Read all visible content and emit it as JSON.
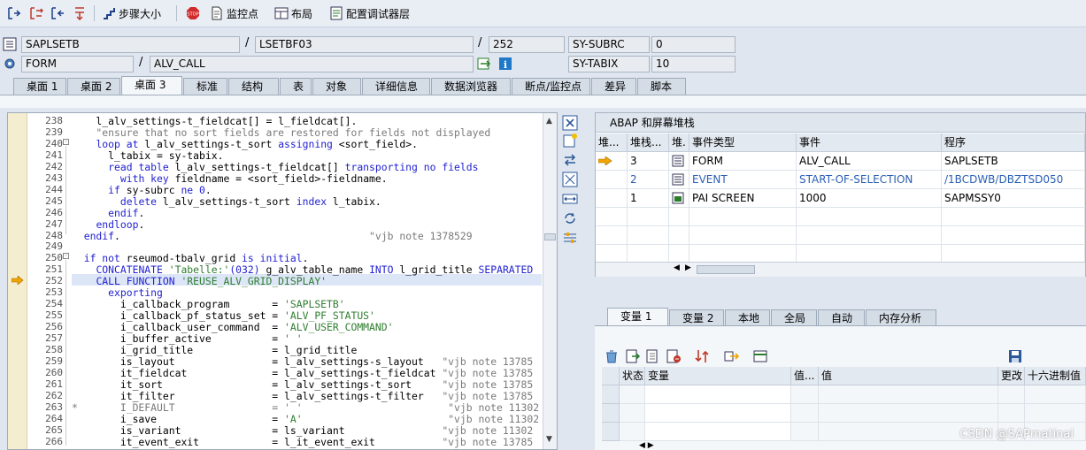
{
  "toolbar": {
    "step_size": "步骤大小",
    "watchpoint": "监控点",
    "layout": "布局",
    "config_layers": "配置调试器层"
  },
  "context": {
    "program": "SAPLSETB",
    "include": "LSETBF03",
    "line": "252",
    "subrc_label": "SY-SUBRC",
    "subrc_value": "0",
    "event_type": "FORM",
    "event_name": "ALV_CALL",
    "tabix_label": "SY-TABIX",
    "tabix_value": "10"
  },
  "tabs": [
    "桌面 1",
    "桌面 2",
    "桌面 3",
    "标准",
    "结构",
    "表",
    "对象",
    "详细信息",
    "数据浏览器",
    "断点/监控点",
    "差异",
    "脚本"
  ],
  "active_tab": "桌面 3",
  "code_lines": [
    {
      "n": "238",
      "segs": [
        [
          "t",
          "    l_alv_settings-t_fieldcat[] = l_fieldcat[]."
        ]
      ]
    },
    {
      "n": "239",
      "segs": [
        [
          "c",
          "    \"ensure that no sort fields are restored for fields not displayed"
        ]
      ]
    },
    {
      "n": "240",
      "segs": [
        [
          "t",
          "    "
        ],
        [
          "k",
          "loop at"
        ],
        [
          "t",
          " l_alv_settings-t_sort "
        ],
        [
          "k",
          "assigning"
        ],
        [
          "t",
          " <sort_field>."
        ]
      ]
    },
    {
      "n": "241",
      "segs": [
        [
          "t",
          "      l_tabix = sy-tabix."
        ]
      ]
    },
    {
      "n": "242",
      "segs": [
        [
          "t",
          "      "
        ],
        [
          "k",
          "read table"
        ],
        [
          "t",
          " l_alv_settings-t_fieldcat[] "
        ],
        [
          "k",
          "transporting no fields"
        ]
      ]
    },
    {
      "n": "243",
      "segs": [
        [
          "t",
          "        "
        ],
        [
          "k",
          "with key"
        ],
        [
          "t",
          " fieldname = <sort_field>-fieldname."
        ]
      ]
    },
    {
      "n": "244",
      "segs": [
        [
          "t",
          "      "
        ],
        [
          "k",
          "if"
        ],
        [
          "t",
          " sy-subrc "
        ],
        [
          "k",
          "ne"
        ],
        [
          "t",
          " "
        ],
        [
          "n",
          "0"
        ],
        [
          "t",
          "."
        ]
      ]
    },
    {
      "n": "245",
      "segs": [
        [
          "t",
          "        "
        ],
        [
          "k",
          "delete"
        ],
        [
          "t",
          " l_alv_settings-t_sort "
        ],
        [
          "k",
          "index"
        ],
        [
          "t",
          " l_tabix."
        ]
      ]
    },
    {
      "n": "246",
      "segs": [
        [
          "t",
          "      "
        ],
        [
          "k",
          "endif"
        ],
        [
          "t",
          "."
        ]
      ]
    },
    {
      "n": "247",
      "segs": [
        [
          "t",
          "    "
        ],
        [
          "k",
          "endloop"
        ],
        [
          "t",
          "."
        ]
      ]
    },
    {
      "n": "248",
      "segs": [
        [
          "t",
          "  "
        ],
        [
          "k",
          "endif"
        ],
        [
          "t",
          ".                                         "
        ],
        [
          "c",
          "\"vjb note 1378529"
        ]
      ]
    },
    {
      "n": "249",
      "segs": [
        [
          "t",
          ""
        ]
      ]
    },
    {
      "n": "250",
      "segs": [
        [
          "t",
          "  "
        ],
        [
          "k",
          "if not"
        ],
        [
          "t",
          " rseumod-tbalv_grid "
        ],
        [
          "k",
          "is initial"
        ],
        [
          "t",
          "."
        ]
      ]
    },
    {
      "n": "251",
      "segs": [
        [
          "t",
          "    "
        ],
        [
          "k",
          "CONCATENATE"
        ],
        [
          "t",
          " "
        ],
        [
          "s",
          "'Tabelle:'"
        ],
        [
          "n",
          "(032)"
        ],
        [
          "t",
          " g_alv_table_name "
        ],
        [
          "k",
          "INTO"
        ],
        [
          "t",
          " l_grid_title "
        ],
        [
          "k",
          "SEPARATED"
        ]
      ]
    },
    {
      "n": "252",
      "segs": [
        [
          "t",
          "    "
        ],
        [
          "k",
          "CALL FUNCTION"
        ],
        [
          "t",
          " "
        ],
        [
          "s",
          "'REUSE_ALV_GRID_DISPLAY'"
        ]
      ]
    },
    {
      "n": "253",
      "segs": [
        [
          "t",
          "      "
        ],
        [
          "k",
          "exporting"
        ]
      ]
    },
    {
      "n": "254",
      "segs": [
        [
          "t",
          "        i_callback_program       = "
        ],
        [
          "s",
          "'SAPLSETB'"
        ]
      ]
    },
    {
      "n": "255",
      "segs": [
        [
          "t",
          "        i_callback_pf_status_set = "
        ],
        [
          "s",
          "'ALV_PF_STATUS'"
        ]
      ]
    },
    {
      "n": "256",
      "segs": [
        [
          "t",
          "        i_callback_user_command  = "
        ],
        [
          "s",
          "'ALV_USER_COMMAND'"
        ]
      ]
    },
    {
      "n": "257",
      "segs": [
        [
          "t",
          "        i_buffer_active          = "
        ],
        [
          "s",
          "' '"
        ]
      ]
    },
    {
      "n": "258",
      "segs": [
        [
          "t",
          "        i_grid_title             = l_grid_title"
        ]
      ]
    },
    {
      "n": "259",
      "segs": [
        [
          "t",
          "        is_layout                = l_alv_settings-s_layout   "
        ],
        [
          "c",
          "\"vjb note 13785"
        ]
      ]
    },
    {
      "n": "260",
      "segs": [
        [
          "t",
          "        it_fieldcat              = l_alv_settings-t_fieldcat "
        ],
        [
          "c",
          "\"vjb note 13785"
        ]
      ]
    },
    {
      "n": "261",
      "segs": [
        [
          "t",
          "        it_sort                  = l_alv_settings-t_sort     "
        ],
        [
          "c",
          "\"vjb note 13785"
        ]
      ]
    },
    {
      "n": "262",
      "segs": [
        [
          "t",
          "        it_filter                = l_alv_settings-t_filter   "
        ],
        [
          "c",
          "\"vjb note 13785"
        ]
      ]
    },
    {
      "n": "263",
      "segs": [
        [
          "c",
          "*       I_DEFAULT                = ' '                        \"vjb note 11302"
        ]
      ]
    },
    {
      "n": "264",
      "segs": [
        [
          "t",
          "        i_save                   = "
        ],
        [
          "s",
          "'A'"
        ],
        [
          "t",
          "                        "
        ],
        [
          "c",
          "\"vjb note 11302"
        ]
      ]
    },
    {
      "n": "265",
      "segs": [
        [
          "t",
          "        is_variant               = ls_variant                "
        ],
        [
          "c",
          "\"vjb note 11302"
        ]
      ]
    },
    {
      "n": "266",
      "segs": [
        [
          "t",
          "        it_event_exit            = l_it_event_exit           "
        ],
        [
          "c",
          "\"vjb note 13785"
        ]
      ]
    }
  ],
  "stack": {
    "title": "ABAP 和屏幕堆栈",
    "headers": [
      "堆...",
      "堆栈...",
      "堆.",
      "事件类型",
      "事件",
      "程序"
    ],
    "rows": [
      {
        "level": "3",
        "type": "FORM",
        "event": "ALV_CALL",
        "program": "SAPLSETB",
        "link": false,
        "current": true
      },
      {
        "level": "2",
        "type": "EVENT",
        "event": "START-OF-SELECTION",
        "program": "/1BCDWB/DBZTSD050",
        "link": true,
        "current": false
      },
      {
        "level": "1",
        "type": "PAI SCREEN",
        "event": "1000",
        "program": "SAPMSSY0",
        "link": false,
        "current": false
      }
    ]
  },
  "var_tabs": [
    "变量 1",
    "变量 2",
    "本地",
    "全局",
    "自动",
    "内存分析"
  ],
  "var_headers": [
    "状态",
    "变量",
    "值...",
    "值",
    "更改",
    "十六进制值"
  ],
  "watermark": "CSDN @SAPmatinal"
}
